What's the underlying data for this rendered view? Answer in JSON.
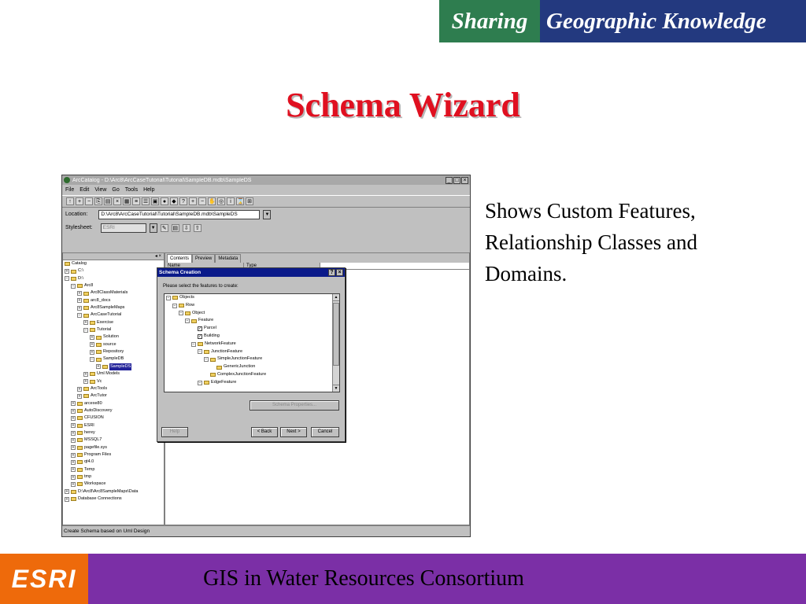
{
  "banner": {
    "part1": "Sharing",
    "part2": "Geographic Knowledge"
  },
  "slide": {
    "title": "Schema Wizard",
    "description": "Shows Custom Features, Relationship Classes and Domains.",
    "footer_text": "GIS in Water Resources Consortium",
    "footer_logo": "ESRI"
  },
  "window": {
    "title": "ArcCatalog - D:\\Arc8\\ArcCaseTutorial\\Tutorial\\SampleDB.mdb\\SampleDS",
    "menu": [
      "File",
      "Edit",
      "View",
      "Go",
      "Tools",
      "Help"
    ],
    "location_label": "Location:",
    "location_value": "D:\\Arc8\\ArcCaseTutorial\\Tutorial\\SampleDB.mdb\\SampleDS",
    "stylesheet_label": "Stylesheet:",
    "stylesheet_value": "ESRI",
    "tabs": [
      "Contents",
      "Preview",
      "Metadata"
    ],
    "columns": [
      "Name",
      "Type"
    ],
    "status": "Create Schema based on Uml Design",
    "tree": [
      "Catalog",
      "C:\\",
      "D:\\",
      "Arc8",
      "Arc8ClassMaterials",
      "arc8_docs",
      "Arc8SampleMaps",
      "ArcCaseTutorial",
      "Exercise",
      "Tutorial",
      "Solution",
      "source",
      "Repository",
      "SampleDB",
      "SampleDS",
      "Uml Models",
      "Vc",
      "ArcTools",
      "ArcTutor",
      "arcexe80",
      "AutoDiscovery",
      "CFUSION",
      "ESRI",
      "herey",
      "MSSQL7",
      "pagefile.sys",
      "Program Files",
      "qt4.0",
      "Temp",
      "tmp",
      "Workspace",
      "D:\\Arc8\\Arc8SampleMaps\\Data",
      "Database Connections"
    ]
  },
  "dialog": {
    "title": "Schema Creation",
    "prompt": "Please select the features to create:",
    "tree": [
      "Objects",
      "Row",
      "Object",
      "Feature",
      "Parcel",
      "Building",
      "NetworkFeature",
      "JunctionFeature",
      "SimpleJunctionFeature",
      "GenericJunction",
      "ComplexJunctionFeature",
      "EdgeFeature"
    ],
    "schema_properties_button": "Schema Properties...",
    "help_button": "Help",
    "back_button": "< Back",
    "next_button": "Next >",
    "cancel_button": "Cancel"
  },
  "colors": {
    "title_red": "#e01020",
    "banner_green": "#2e7d4f",
    "banner_blue": "#23397f",
    "footer_purple": "#7b2fa6",
    "esri_orange": "#ee6a0b",
    "dialog_title_blue": "#0a1a8a"
  }
}
